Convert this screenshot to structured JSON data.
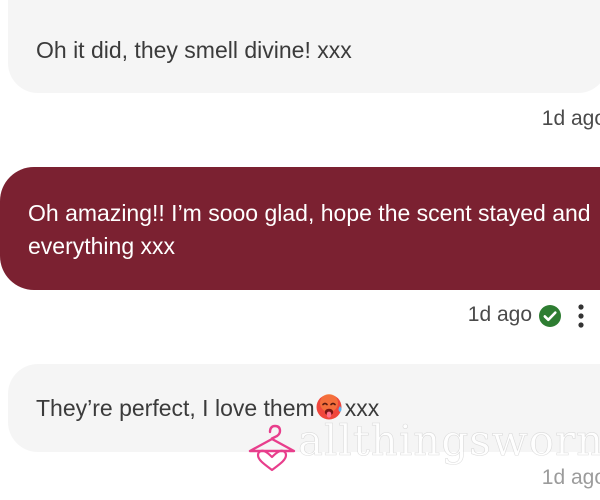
{
  "colors": {
    "incoming_bubble": "#f5f5f5",
    "outgoing_bubble": "#7b2131",
    "check": "#2e7d32",
    "logo": "#e83e8c"
  },
  "messages": [
    {
      "direction": "incoming",
      "text": "Oh it did, they smell divine! xxx",
      "time": "1d ago"
    },
    {
      "direction": "outgoing",
      "text": "Oh amazing!! I’m sooo glad, hope the scent stayed and everything xxx",
      "time": "1d ago",
      "status_icon": "check-circle-icon"
    },
    {
      "direction": "incoming",
      "text": "They’re perfect, I love them",
      "text_after": "xxx",
      "emoji": "hot-face-emoji",
      "time": "1d ago"
    }
  ],
  "watermark": {
    "text": "allthingsworn",
    "logo_icon": "hanger-heart-icon"
  }
}
